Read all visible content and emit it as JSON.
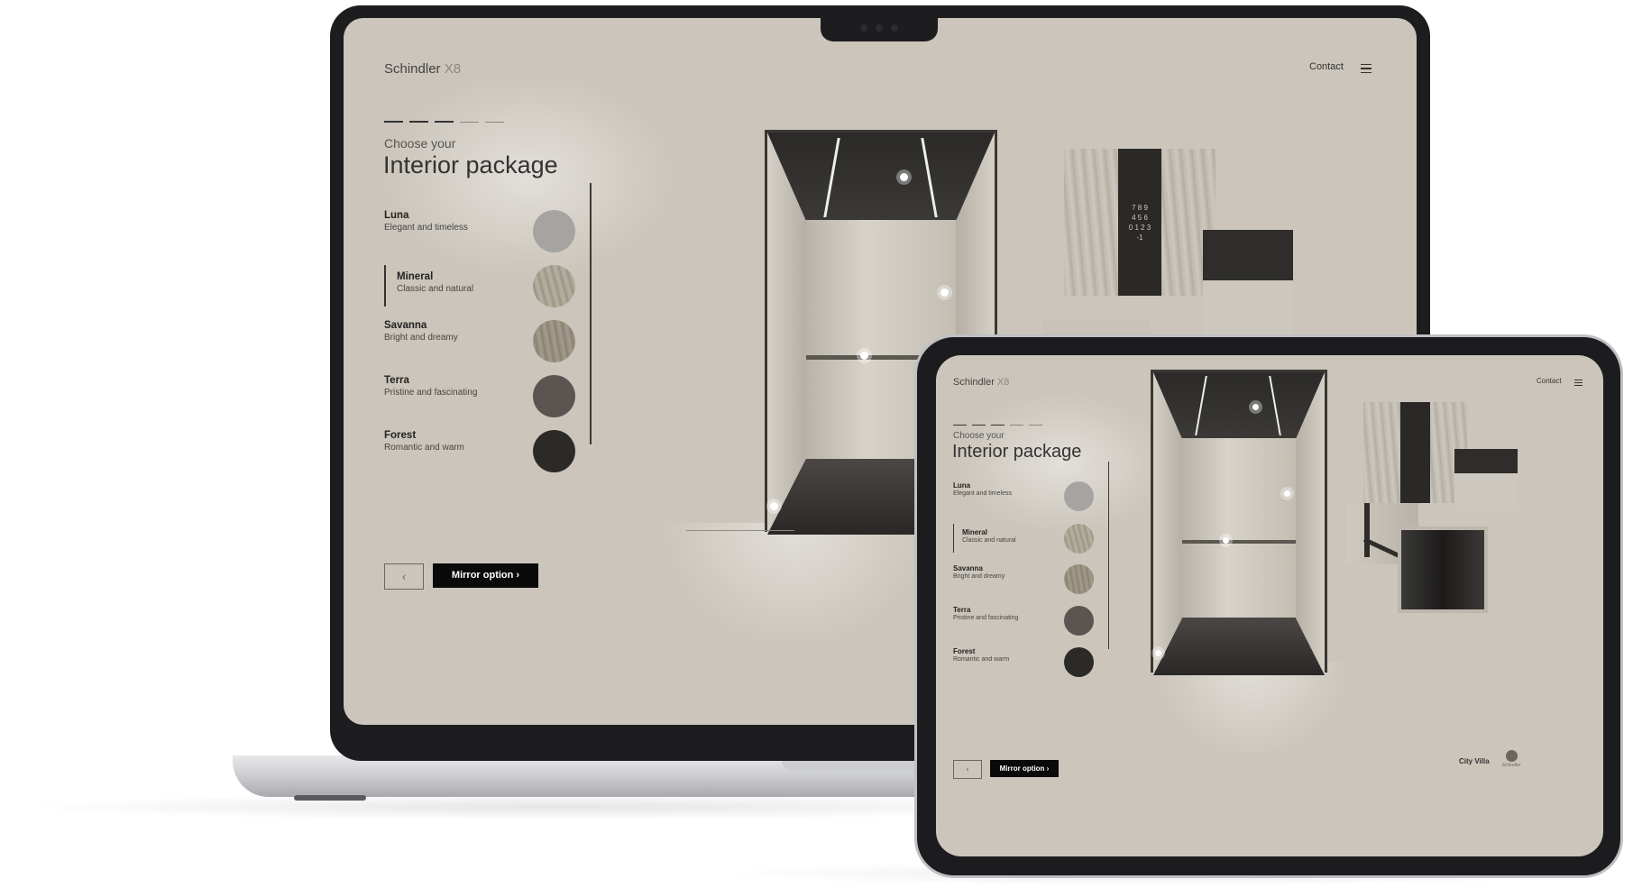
{
  "laptop": {
    "brand": "Schindler",
    "brand_mark": "X8",
    "contact": "Contact",
    "subtitle": "Choose your",
    "title": "Interior package",
    "options": [
      {
        "name": "Luna",
        "desc": "Elegant and timeless",
        "color": "#a6a4a1"
      },
      {
        "name": "Mineral",
        "desc": "Classic and natural",
        "color": "#a59f90"
      },
      {
        "name": "Savanna",
        "desc": "Bright and dreamy",
        "color": "#938c7c"
      },
      {
        "name": "Terra",
        "desc": "Pristine and fascinating",
        "color": "#5a5550"
      },
      {
        "name": "Forest",
        "desc": "Romantic and warm",
        "color": "#2c2a27"
      }
    ],
    "back_label": "‹",
    "mirror_label": "Mirror option ›",
    "panel_digits": [
      "7 8 9",
      "4 5 6",
      "0 1 2 3",
      "-1"
    ]
  },
  "tablet": {
    "brand": "Schindler",
    "brand_mark": "X8",
    "contact": "Contact",
    "subtitle": "Choose your",
    "title": "Interior package",
    "options": [
      {
        "name": "Luna",
        "desc": "Elegant and timeless",
        "color": "#a6a4a1"
      },
      {
        "name": "Mineral",
        "desc": "Classic and natural",
        "color": "#a59f90"
      },
      {
        "name": "Savanna",
        "desc": "Bright and dreamy",
        "color": "#938c7c"
      },
      {
        "name": "Terra",
        "desc": "Pristine and fascinating",
        "color": "#5a5550"
      },
      {
        "name": "Forest",
        "desc": "Romantic and warm",
        "color": "#2c2a27"
      }
    ],
    "back_label": "‹",
    "mirror_label": "Mirror option ›",
    "footer_label": "City Villa",
    "footer_logo_text": "Schindler"
  },
  "colors": {
    "screen_bg": "#cbc5bb",
    "device_dark": "#1d1d1f",
    "button_dark": "#0a0a0a"
  }
}
